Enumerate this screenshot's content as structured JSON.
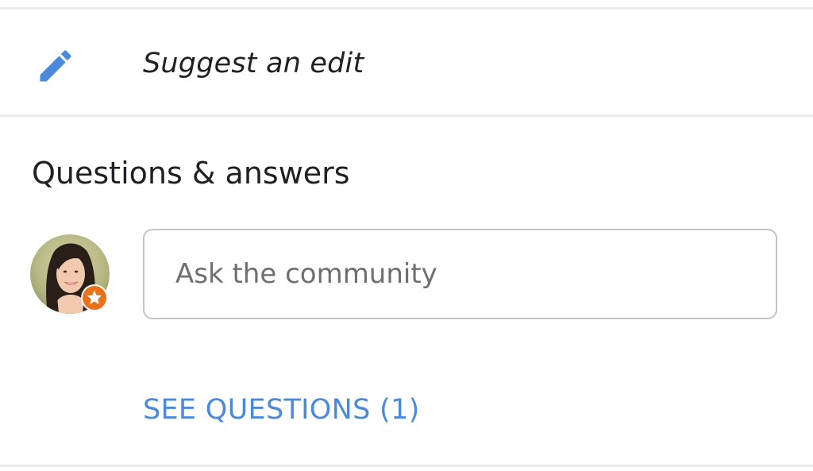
{
  "suggest_edit": {
    "icon": "pencil-icon",
    "label": "Suggest an edit"
  },
  "qa": {
    "heading": "Questions & answers",
    "avatar": {
      "badge_icon": "star-icon",
      "badge_color": "#e8711a"
    },
    "input": {
      "placeholder": "Ask the community",
      "value": ""
    },
    "see_questions_label": "SEE QUESTIONS (1)"
  },
  "colors": {
    "accent_blue": "#4a89dc",
    "divider": "#ececec",
    "input_border": "#c4c4c4",
    "badge_orange": "#e8711a"
  }
}
